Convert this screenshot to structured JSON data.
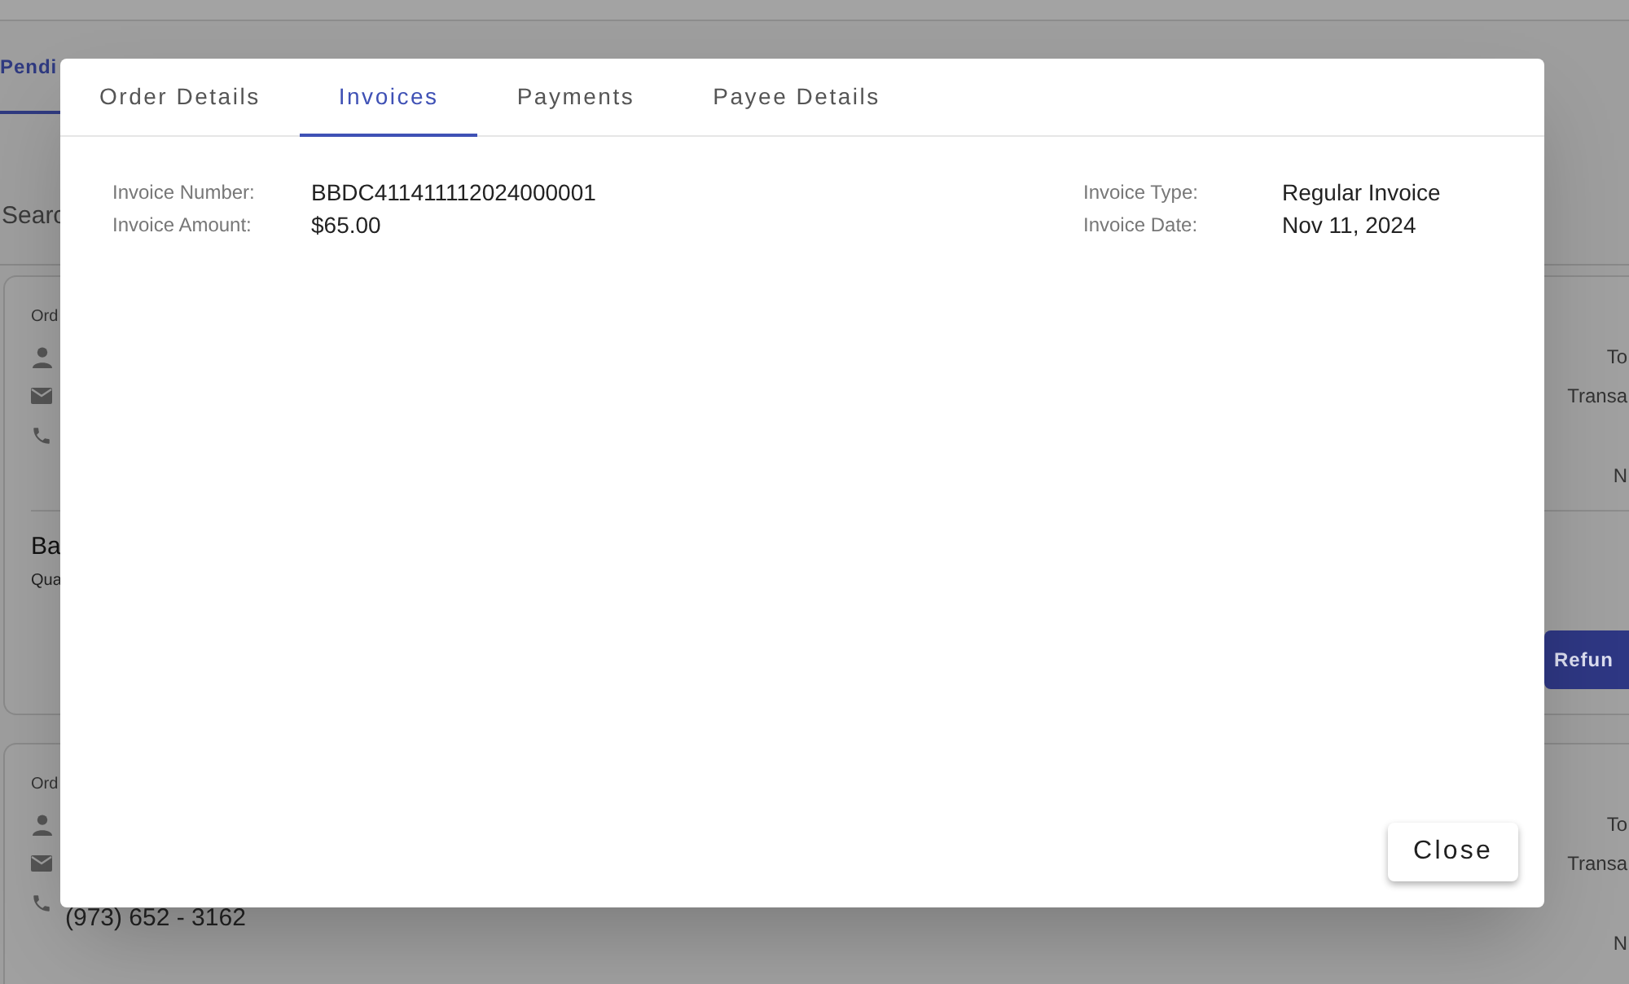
{
  "background": {
    "tab": {
      "label": "Pendi",
      "selected": true
    },
    "search_label": "Searc",
    "cards": [
      {
        "order_label": "Ord",
        "contacts": [
          {
            "kind": "person"
          },
          {
            "kind": "email"
          },
          {
            "kind": "phone"
          }
        ],
        "right_labels": [
          "To",
          "Transa",
          "N"
        ],
        "title": "Ba",
        "subtitle": "Qua",
        "button": "Refun"
      },
      {
        "order_label": "Ord",
        "contacts": [
          {
            "kind": "person"
          },
          {
            "kind": "email"
          },
          {
            "kind": "phone",
            "text": "(973) 652 - 3162"
          }
        ],
        "right_labels": [
          "To",
          "Transa",
          "N"
        ]
      }
    ]
  },
  "dialog": {
    "tabs": [
      {
        "label": "Order Details",
        "selected": false
      },
      {
        "label": "Invoices",
        "selected": true
      },
      {
        "label": "Payments",
        "selected": false
      },
      {
        "label": "Payee Details",
        "selected": false
      }
    ],
    "fields_left": [
      {
        "label": "Invoice Number:",
        "value": "BBDC411411112024000001"
      },
      {
        "label": "Invoice Amount:",
        "value": "$65.00"
      }
    ],
    "fields_right": [
      {
        "label": "Invoice Type:",
        "value": "Regular Invoice"
      },
      {
        "label": "Invoice Date:",
        "value": "Nov 11, 2024"
      }
    ],
    "close_button": "Close"
  }
}
